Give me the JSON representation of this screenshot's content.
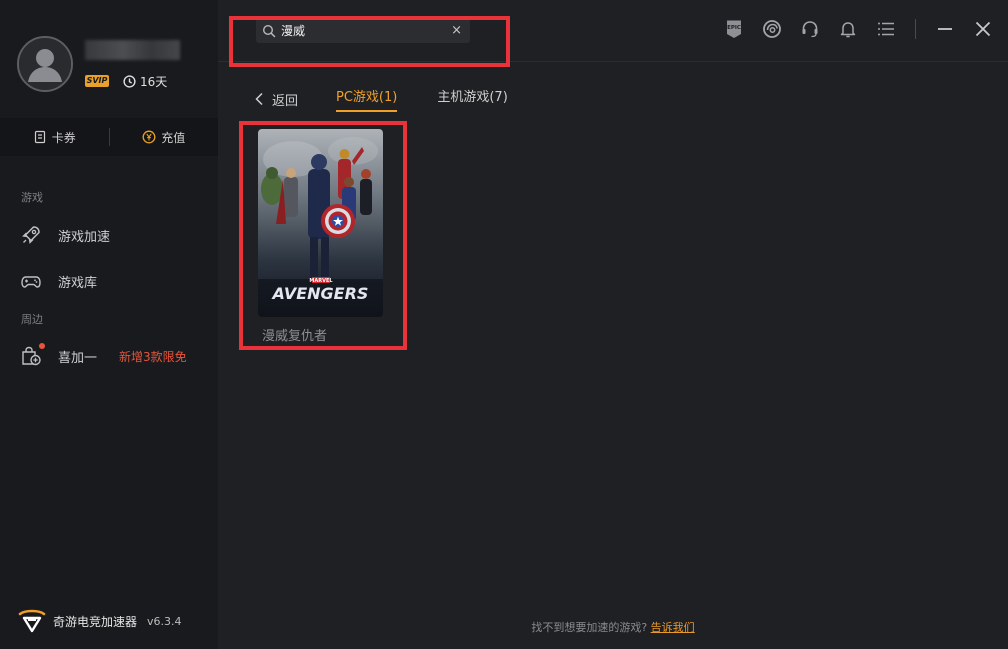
{
  "user": {
    "badge": "SVIP",
    "days_left": "16天"
  },
  "wallet": {
    "coupon_label": "卡券",
    "recharge_label": "充值"
  },
  "sidebar": {
    "section_games": "游戏",
    "items": [
      {
        "label": "游戏加速",
        "icon": "rocket-icon"
      },
      {
        "label": "游戏库",
        "icon": "gamepad-icon"
      }
    ],
    "section_extras": "周边",
    "extras": [
      {
        "label": "喜加一",
        "icon": "gift-bag-icon",
        "promo": "新增3款限免"
      }
    ]
  },
  "brand": {
    "name": "奇游电竞加速器",
    "version": "v6.3.4"
  },
  "search": {
    "value": "漫威",
    "clear": "×"
  },
  "toolbar": {
    "icons": [
      "epic-games-icon",
      "ubisoft-icon",
      "headset-icon",
      "bell-icon",
      "menu-icon",
      "minimize-icon",
      "close-icon"
    ],
    "epic_text": "EPIC"
  },
  "tabs": {
    "back_label": "返回",
    "items": [
      {
        "label": "PC游戏(1)",
        "active": true
      },
      {
        "label": "主机游戏(7)",
        "active": false
      }
    ]
  },
  "results": [
    {
      "title": "漫威复仇者",
      "cover_brand": "MARVEL",
      "cover_logo": "AVENGERS"
    }
  ],
  "footer": {
    "text": "找不到想要加速的游戏?",
    "link": "告诉我们"
  },
  "colors": {
    "accent": "#f0a02a",
    "highlight": "#e8333a",
    "promo": "#e8553d",
    "sidebar_bg": "#191a1d",
    "main_bg": "#1f2023"
  }
}
